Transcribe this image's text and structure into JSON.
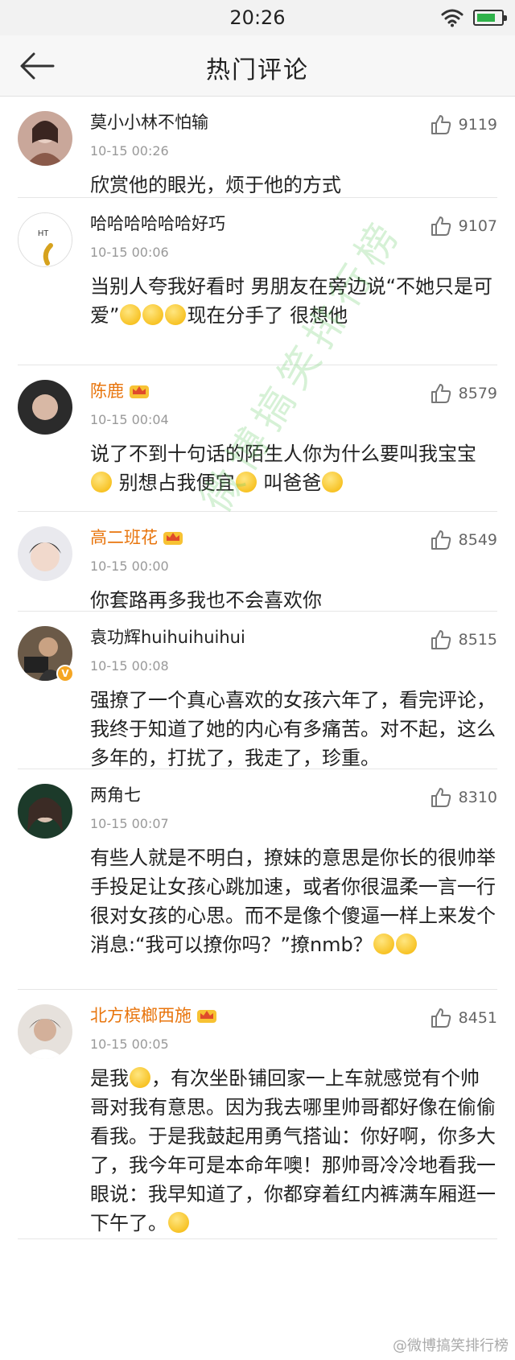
{
  "status": {
    "time": "20:26",
    "battery_level": 0.85
  },
  "nav": {
    "title": "热门评论"
  },
  "watermark": "微博搞笑排行榜",
  "footer": {
    "credit": "@微博搞笑排行榜"
  },
  "comments": [
    {
      "user": "莫小小林不怕输",
      "time": "10-15 00:26",
      "likes": "9119",
      "text": "欣赏他的眼光，烦于他的方式",
      "vip": false
    },
    {
      "user": "哈哈哈哈哈哈好巧",
      "time": "10-15 00:06",
      "likes": "9107",
      "text_a": "当别人夸我好看时 男朋友在旁边说“不她只是可爱”",
      "text_b": "现在分手了 很想他",
      "vip": false
    },
    {
      "user": "陈鹿",
      "time": "10-15 00:04",
      "likes": "8579",
      "text_a": "说了不到十句话的陌生人你为什么要叫我宝宝",
      "text_b": " 别想占我便宜",
      "text_c": " 叫爸爸",
      "vip": true
    },
    {
      "user": "高二班花",
      "time": "10-15 00:00",
      "likes": "8549",
      "text": "你套路再多我也不会喜欢你",
      "vip": true
    },
    {
      "user": "袁功辉huihuihuihui",
      "time": "10-15 00:08",
      "likes": "8515",
      "text": "强撩了一个真心喜欢的女孩六年了，看完评论，我终于知道了她的内心有多痛苦。对不起，这么多年的，打扰了，我走了，珍重。",
      "vip": false
    },
    {
      "user": "两角七",
      "time": "10-15 00:07",
      "likes": "8310",
      "text_a": "有些人就是不明白，撩妹的意思是你长的很帅举手投足让女孩心跳加速，或者你很温柔一言一行很对女孩的心思。而不是像个傻逼一样上来发个消息:“我可以撩你吗？”撩nmb？",
      "vip": false
    },
    {
      "user": "北方槟榔西施",
      "time": "10-15 00:05",
      "likes": "8451",
      "text_a": "是我",
      "text_b": "，有次坐卧铺回家一上车就感觉有个帅哥对我有意思。因为我去哪里帅哥都好像在偷偷看我。于是我鼓起用勇气搭讪：你好啊，你多大了，我今年可是本命年噢！那帅哥冷冷地看我一眼说：我早知道了，你都穿着红内裤满车厢逛一下午了。",
      "vip": true
    }
  ]
}
